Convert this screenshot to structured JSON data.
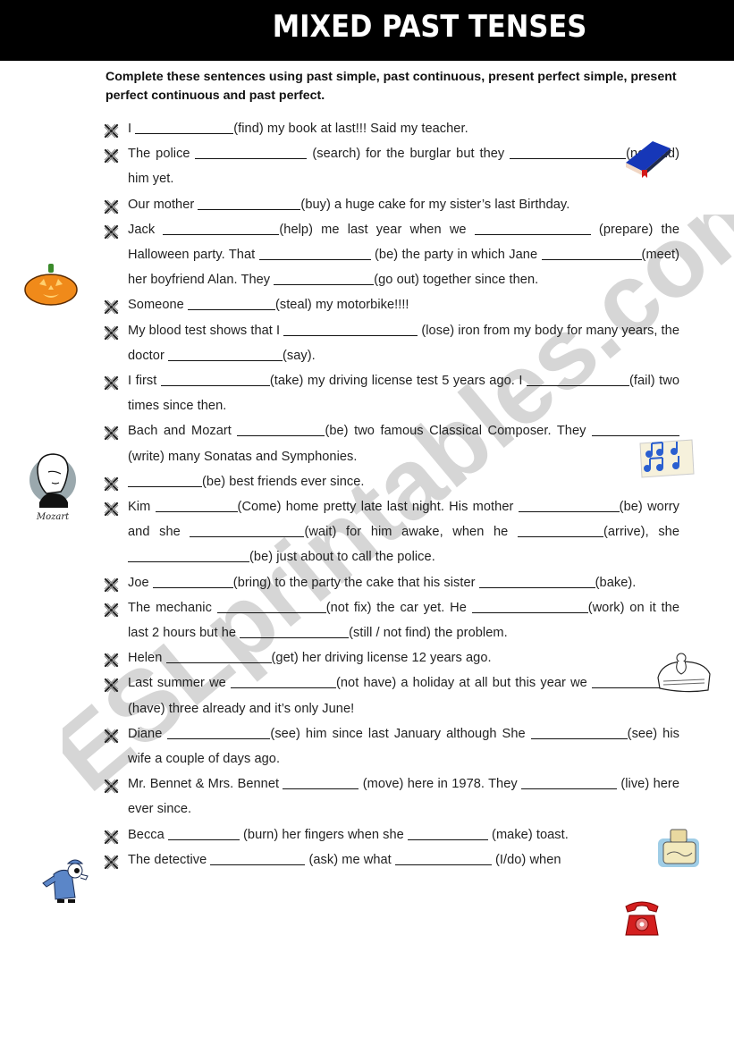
{
  "title": "MIXED PAST TENSES",
  "instructions": "Complete these sentences using past simple, past continuous, present perfect simple, present perfect continuous and past perfect.",
  "watermark": "ESLprintables.com",
  "colors": {
    "title_bg": "#000000",
    "title_fg": "#ffffff",
    "watermark": "#c8c8c8"
  },
  "bullet_icon": "crossed-pens-bullet-icon",
  "items": [
    {
      "parts": [
        "I ",
        {
          "blank": 110
        },
        "(find)  my book at last!!! Said my teacher."
      ]
    },
    {
      "parts": [
        "The police ",
        {
          "blank": 125
        },
        " (search) for the burglar but they ",
        {
          "blank": 130
        },
        "(not find) him yet."
      ]
    },
    {
      "parts": [
        "Our mother ",
        {
          "blank": 115
        },
        "(buy) a huge cake for my sister’s last Birthday."
      ]
    },
    {
      "parts": [
        "Jack ",
        {
          "blank": 130
        },
        "(help) me  last year  when we ",
        {
          "blank": 130
        },
        " (prepare) the Halloween party. That ",
        {
          "blank": 125
        },
        " (be) the party in which Jane ",
        {
          "blank": 112
        },
        "(meet) her boyfriend Alan. They ",
        {
          "blank": 112
        },
        "(go out) together since then."
      ]
    },
    {
      "parts": [
        "Someone ",
        {
          "blank": 98
        },
        "(steal) my motorbike!!!!"
      ]
    },
    {
      "parts": [
        "My blood test shows that I ",
        {
          "blank": 150
        },
        " (lose) iron from  my body for many years, the doctor ",
        {
          "blank": 128
        },
        "(say)."
      ]
    },
    {
      "parts": [
        "I first ",
        {
          "blank": 122
        },
        "(take) my  driving license test 5 years ago. I ",
        {
          "blank": 115
        },
        "(fail) two times since then."
      ]
    },
    {
      "parts": [
        "Bach and Mozart ",
        {
          "blank": 98
        },
        "(be) two famous Classical Composer. They ",
        {
          "blank": 98
        },
        "(write) many Sonatas and Symphonies."
      ]
    },
    {
      "parts": [
        {
          "blank": 83
        },
        "(be)  best friends ever since."
      ]
    },
    {
      "parts": [
        "Kim ",
        {
          "blank": 92
        },
        "(Come) home pretty late last night. His mother ",
        {
          "blank": 113
        },
        "(be)  worry and she ",
        {
          "blank": 128
        },
        "(wait) for him awake, when he ",
        {
          "blank": 96
        },
        "(arrive), she ",
        {
          "blank": 136
        },
        "(be) just about to call the police."
      ]
    },
    {
      "parts": [
        "Joe ",
        {
          "blank": 90
        },
        "(bring) to the party the cake that his sister ",
        {
          "blank": 130
        },
        "(bake)."
      ]
    },
    {
      "parts": [
        "The mechanic ",
        {
          "blank": 122
        },
        "(not fix) the car yet. He ",
        {
          "blank": 130
        },
        "(work) on it the last 2 hours but he ",
        {
          "blank": 122
        },
        "(still / not find) the problem."
      ]
    },
    {
      "parts": [
        "Helen ",
        {
          "blank": 118
        },
        "(get) her driving license 12 years ago."
      ]
    },
    {
      "parts": [
        "Last summer we ",
        {
          "blank": 118
        },
        "(not have) a holiday at all but this year we ",
        {
          "blank": 98
        },
        "(have) three already and it’s only June!"
      ]
    },
    {
      "parts": [
        "Diane ",
        {
          "blank": 115
        },
        "(see) him since last January although She ",
        {
          "blank": 108
        },
        "(see) his wife a couple of days ago."
      ]
    },
    {
      "parts": [
        "Mr. Bennet & Mrs. Bennet ",
        {
          "blank": 85
        },
        " (move) here in 1978. They ",
        {
          "blank": 107
        },
        " (live) here ever since."
      ]
    },
    {
      "parts": [
        "Becca ",
        {
          "blank": 80
        },
        " (burn) her fingers when she ",
        {
          "blank": 90
        },
        " (make) toast."
      ]
    },
    {
      "parts": [
        "The detective ",
        {
          "blank": 106
        },
        " (ask) me what ",
        {
          "blank": 108
        },
        " (I/do)  when"
      ]
    }
  ],
  "images": {
    "book": "blue-book-icon",
    "pumpkin": "halloween-pumpkin-icon",
    "mozart": "mozart-portrait",
    "mozart_caption": "Mozart",
    "music": "music-notes-icon",
    "mechanic": "mechanic-car-icon",
    "toaster": "toaster-icon",
    "detective": "detective-icon",
    "telephone": "red-telephone-icon"
  }
}
